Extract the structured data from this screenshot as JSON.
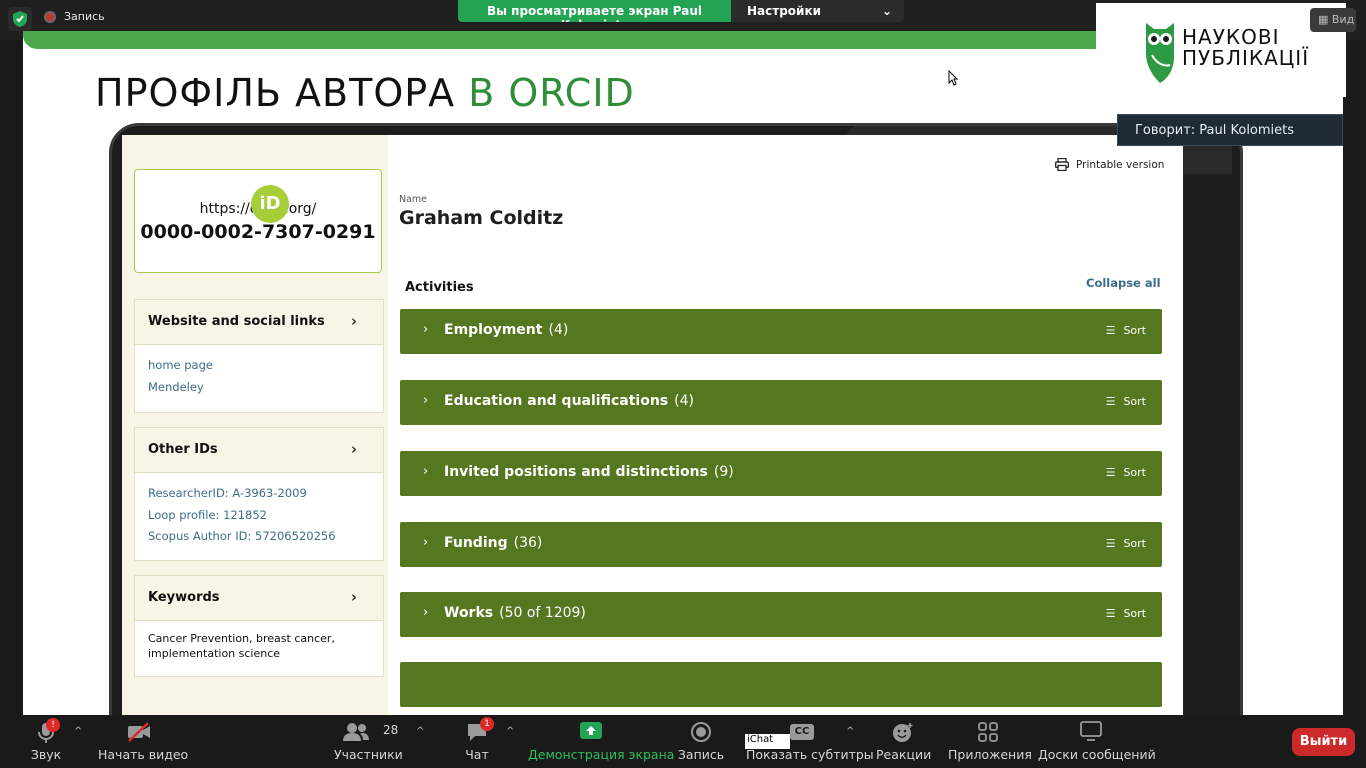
{
  "zoom_top": {
    "recording_label": "Запись",
    "share_banner_text": "Вы просматриваете экран Paul Kolomiets",
    "view_settings_label": "Настройки просмотра",
    "view_button_label": "Вид"
  },
  "slide": {
    "title_main": "ПРОФІЛЬ АВТОРА",
    "title_accent": "В ORCID",
    "logo_line1": "НАУКОВІ",
    "logo_line2": "ПУБЛІКАЦІЇ",
    "speaker_label": "Говорит: Paul Kolomiets"
  },
  "orcid": {
    "id_badge": "iD",
    "url": "https://orcid.org/",
    "id_number": "0000-0002-7307-0291",
    "panels": [
      {
        "title": "Website and social links",
        "links": [
          "home page",
          "Mendeley"
        ]
      },
      {
        "title": "Other IDs",
        "links": [
          "ResearcherID: A-3963-2009",
          "Loop profile: 121852",
          "Scopus Author ID: 57206520256"
        ]
      },
      {
        "title": "Keywords",
        "text": "Cancer Prevention, breast cancer, implementation science"
      }
    ],
    "printable_label": "Printable version",
    "name_label": "Name",
    "name": "Graham Colditz",
    "activities_label": "Activities",
    "collapse_label": "Collapse all",
    "sort_label": "Sort",
    "sections": [
      {
        "label": "Employment",
        "count": "(4)"
      },
      {
        "label": "Education and qualifications",
        "count": "(4)"
      },
      {
        "label": "Invited positions and distinctions",
        "count": "(9)"
      },
      {
        "label": "Funding",
        "count": "(36)"
      },
      {
        "label": "Works",
        "count": "(50 of 1209)"
      }
    ]
  },
  "toolbar": {
    "audio_label": "Звук",
    "audio_badge": "!",
    "video_label": "Начать видео",
    "participants_count": "28",
    "participants_label": "Участники",
    "chat_badge": "1",
    "chat_label": "Чат",
    "share_label": "Демонстрация экрана",
    "record_label": "Запись",
    "ichat_label": "iChat",
    "cc_label": "CC",
    "captions_label": "Показать субтитры",
    "reactions_label": "Реакции",
    "apps_label": "Приложения",
    "whiteboards_label": "Доски сообщений",
    "leave_label": "Выйти"
  },
  "colors": {
    "zoom_green": "#23a455",
    "slide_band": "#4caa4d",
    "orcid_section_green": "#55771f",
    "orcid_id_green": "#a6ce39",
    "link_blue": "#3c6d8c",
    "leave_red": "#cc2a2a"
  }
}
